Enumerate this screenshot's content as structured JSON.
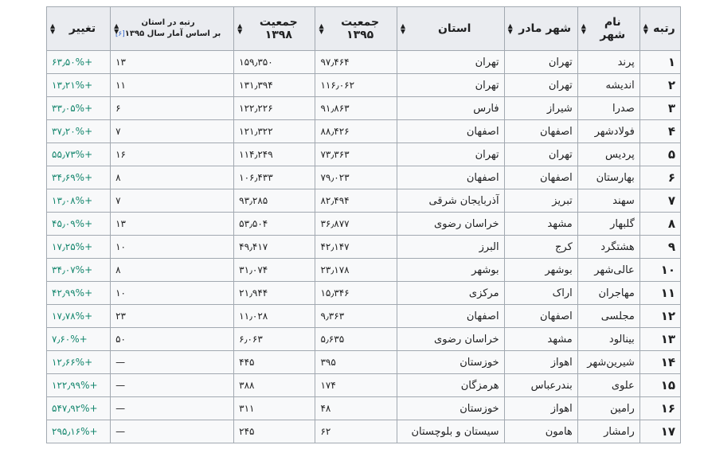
{
  "headers": {
    "rank": "رتبه",
    "city": "نام شهر",
    "mother_city": "شهر مادر",
    "province": "استان",
    "pop_1395": "جمعیت ۱۳۹۵",
    "pop_1398": "جمعیت ۱۳۹۸",
    "rank_province_line1": "رتبه در استان",
    "rank_province_line2": "بر اساس آمار سال ۱۳۹۵",
    "rank_province_cite": "[۶]",
    "change": "تغییر"
  },
  "rows": [
    {
      "rank": "۱",
      "city": "پرند",
      "mother": "تهران",
      "province": "تهران",
      "pop1395": "۹۷٫۴۶۴",
      "pop1398": "۱۵۹٫۳۵۰",
      "rankprov": "۱۳",
      "change": "+۶۳٫۵۰%"
    },
    {
      "rank": "۲",
      "city": "اندیشه",
      "mother": "تهران",
      "province": "تهران",
      "pop1395": "۱۱۶٫۰۶۲",
      "pop1398": "۱۳۱٫۳۹۴",
      "rankprov": "۱۱",
      "change": "+۱۳٫۲۱%"
    },
    {
      "rank": "۳",
      "city": "صدرا",
      "mother": "شیراز",
      "province": "فارس",
      "pop1395": "۹۱٫۸۶۳",
      "pop1398": "۱۲۲٫۲۲۶",
      "rankprov": "۶",
      "change": "+۳۳٫۰۵%"
    },
    {
      "rank": "۴",
      "city": "فولادشهر",
      "mother": "اصفهان",
      "province": "اصفهان",
      "pop1395": "۸۸٫۴۲۶",
      "pop1398": "۱۲۱٫۳۲۲",
      "rankprov": "۷",
      "change": "+۳۷٫۲۰%"
    },
    {
      "rank": "۵",
      "city": "پردیس",
      "mother": "تهران",
      "province": "تهران",
      "pop1395": "۷۳٫۳۶۳",
      "pop1398": "۱۱۴٫۲۴۹",
      "rankprov": "۱۶",
      "change": "+۵۵٫۷۳%"
    },
    {
      "rank": "۶",
      "city": "بهارستان",
      "mother": "اصفهان",
      "province": "اصفهان",
      "pop1395": "۷۹٫۰۲۳",
      "pop1398": "۱۰۶٫۴۳۳",
      "rankprov": "۸",
      "change": "+۳۴٫۶۹%"
    },
    {
      "rank": "۷",
      "city": "سهند",
      "mother": "تبریز",
      "province": "آذربایجان شرقی",
      "pop1395": "۸۲٫۴۹۴",
      "pop1398": "۹۳٫۲۸۵",
      "rankprov": "۷",
      "change": "+۱۳٫۰۸%"
    },
    {
      "rank": "۸",
      "city": "گلبهار",
      "mother": "مشهد",
      "province": "خراسان رضوی",
      "pop1395": "۳۶٫۸۷۷",
      "pop1398": "۵۳٫۵۰۴",
      "rankprov": "۱۳",
      "change": "+۴۵٫۰۹%"
    },
    {
      "rank": "۹",
      "city": "هشتگرد",
      "mother": "کرج",
      "province": "البرز",
      "pop1395": "۴۲٫۱۴۷",
      "pop1398": "۴۹٫۴۱۷",
      "rankprov": "۱۰",
      "change": "+۱۷٫۲۵%"
    },
    {
      "rank": "۱۰",
      "city": "عالی‌شهر",
      "mother": "بوشهر",
      "province": "بوشهر",
      "pop1395": "۲۳٫۱۷۸",
      "pop1398": "۳۱٫۰۷۴",
      "rankprov": "۸",
      "change": "+۳۴٫۰۷%"
    },
    {
      "rank": "۱۱",
      "city": "مهاجران",
      "mother": "اراک",
      "province": "مرکزی",
      "pop1395": "۱۵٫۳۴۶",
      "pop1398": "۲۱٫۹۴۴",
      "rankprov": "۱۰",
      "change": "+۴۲٫۹۹%"
    },
    {
      "rank": "۱۲",
      "city": "مجلسی",
      "mother": "اصفهان",
      "province": "اصفهان",
      "pop1395": "۹٫۳۶۳",
      "pop1398": "۱۱٫۰۲۸",
      "rankprov": "۲۳",
      "change": "+۱۷٫۷۸%"
    },
    {
      "rank": "۱۳",
      "city": "بینالود",
      "mother": "مشهد",
      "province": "خراسان رضوی",
      "pop1395": "۵٫۶۳۵",
      "pop1398": "۶٫۰۶۳",
      "rankprov": "۵۰",
      "change": "+۷٫۶۰%"
    },
    {
      "rank": "۱۴",
      "city": "شیرین‌شهر",
      "mother": "اهواز",
      "province": "خوزستان",
      "pop1395": "۳۹۵",
      "pop1398": "۴۴۵",
      "rankprov": "—",
      "change": "+۱۲٫۶۶%"
    },
    {
      "rank": "۱۵",
      "city": "علوی",
      "mother": "بندرعباس",
      "province": "هرمزگان",
      "pop1395": "۱۷۴",
      "pop1398": "۳۸۸",
      "rankprov": "—",
      "change": "+۱۲۲٫۹۹%"
    },
    {
      "rank": "۱۶",
      "city": "رامین",
      "mother": "اهواز",
      "province": "خوزستان",
      "pop1395": "۴۸",
      "pop1398": "۳۱۱",
      "rankprov": "—",
      "change": "+۵۴۷٫۹۲%"
    },
    {
      "rank": "۱۷",
      "city": "رامشار",
      "mother": "هامون",
      "province": "سیستان و بلوچستان",
      "pop1395": "۶۲",
      "pop1398": "۲۴۵",
      "rankprov": "—",
      "change": "+۲۹۵٫۱۶%"
    }
  ],
  "icons": {
    "sort": "sort-icon"
  },
  "colors": {
    "change_positive": "#14866d",
    "link": "#3366cc",
    "header_bg": "#eaecf0"
  }
}
